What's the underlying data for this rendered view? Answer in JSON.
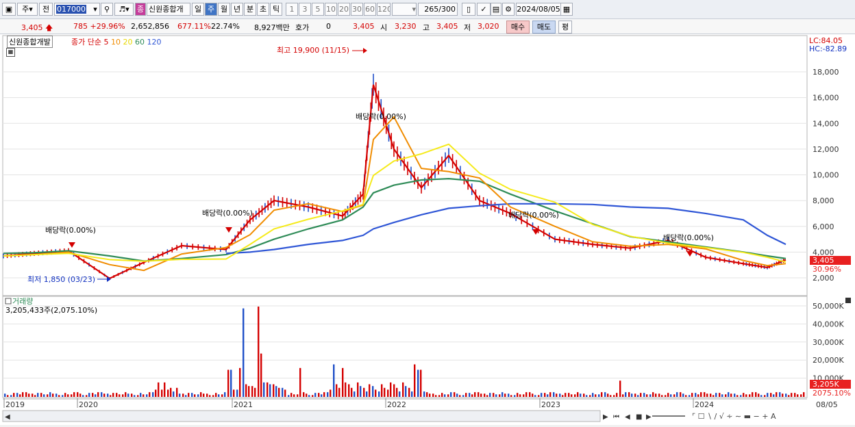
{
  "toolbar": {
    "type_select": "주",
    "prev_label": "전",
    "stock_code": "017000",
    "stock_tag": "종",
    "stock_name": "신원종합개",
    "periods": [
      "일",
      "주",
      "월",
      "년",
      "분",
      "초",
      "틱"
    ],
    "active_period": "주",
    "intervals": [
      "1",
      "3",
      "5",
      "10",
      "20",
      "30",
      "60",
      "120"
    ],
    "count": "265",
    "count_max": "/300",
    "date": "2024/08/05"
  },
  "quote": {
    "price": "3,405",
    "change": "785",
    "change_rate": "+29.96%",
    "volume": "2,652,856",
    "volume_rate": "677.11%",
    "turnover_rate": "22.74%",
    "amount": "8,927백만",
    "hoga_label": "호가",
    "hoga_value": "0",
    "current": "3,405",
    "open_label": "시",
    "open": "3,230",
    "high_label": "고",
    "high": "3,405",
    "low_label": "저",
    "low": "3,020",
    "buy_button": "매수",
    "sell_button": "매도",
    "eval_button": "평"
  },
  "chart": {
    "name_tag": "신원종합개발",
    "ma_title": "종가 단순",
    "ma_periods": [
      {
        "label": "5",
        "color": "#d40000"
      },
      {
        "label": "10",
        "color": "#f08c00"
      },
      {
        "label": "20",
        "color": "#e8d800"
      },
      {
        "label": "60",
        "color": "#2e8b57"
      },
      {
        "label": "120",
        "color": "#2f56d6"
      }
    ],
    "lc": "LC:84.05",
    "hc": "HC:-82.89",
    "price_axis": [
      "18,000",
      "16,000",
      "14,000",
      "12,000",
      "10,000",
      "8,000",
      "6,000",
      "4,000",
      "2,000"
    ],
    "current_price": "3,405",
    "current_rate": "30.96%",
    "annotations": {
      "high": "최고 19,900 (11/15)",
      "low": "최저 1,850 (03/23)",
      "dividend": "배당락(0.00%)",
      "dividend_overlap": "배당락(0.00%)"
    },
    "volume_title": "거래량",
    "volume_info": "3,205,433주(2,075.10%)",
    "volume_axis": [
      "50,000K",
      "40,000K",
      "30,000K",
      "20,000K",
      "10,000K"
    ],
    "current_volume": "3,205K",
    "current_volume_rate": "2075.10%",
    "years": [
      "2019",
      "2020",
      "2021",
      "2022",
      "2023",
      "2024",
      "08/05"
    ]
  },
  "chart_data": {
    "type": "line",
    "x": [
      "2019-01",
      "2019-06",
      "2019-12",
      "2020-03",
      "2020-06",
      "2020-09",
      "2020-12",
      "2021-02",
      "2021-04",
      "2021-06",
      "2021-08",
      "2021-10",
      "2021-11",
      "2022-01",
      "2022-03",
      "2022-05",
      "2022-07",
      "2022-09",
      "2022-12",
      "2023-03",
      "2023-06",
      "2023-09",
      "2023-12",
      "2024-03",
      "2024-06",
      "2024-08"
    ],
    "series": [
      {
        "name": "5",
        "values": [
          3700,
          3900,
          4100,
          1950,
          3200,
          4500,
          4200,
          6500,
          8000,
          7500,
          6800,
          8500,
          17000,
          12000,
          9000,
          11500,
          8000,
          7000,
          5000,
          4600,
          4300,
          4900,
          3600,
          3100,
          2800,
          3405
        ]
      },
      {
        "name": "60",
        "values": [
          3900,
          3950,
          4100,
          3700,
          3300,
          3500,
          3800,
          4300,
          5000,
          5800,
          6500,
          7500,
          8600,
          9200,
          9600,
          9700,
          9500,
          8500,
          7200,
          6200,
          5200,
          4800,
          4400,
          4000,
          3700,
          3500
        ]
      },
      {
        "name": "120",
        "values": [
          null,
          null,
          null,
          null,
          null,
          null,
          3900,
          4000,
          4200,
          4600,
          4900,
          5300,
          5800,
          6300,
          6900,
          7400,
          7600,
          7750,
          7750,
          7700,
          7500,
          7400,
          7000,
          6500,
          5300,
          4600
        ]
      }
    ],
    "ylim": [
      1000,
      20000
    ],
    "high": 19900,
    "low": 1850
  }
}
